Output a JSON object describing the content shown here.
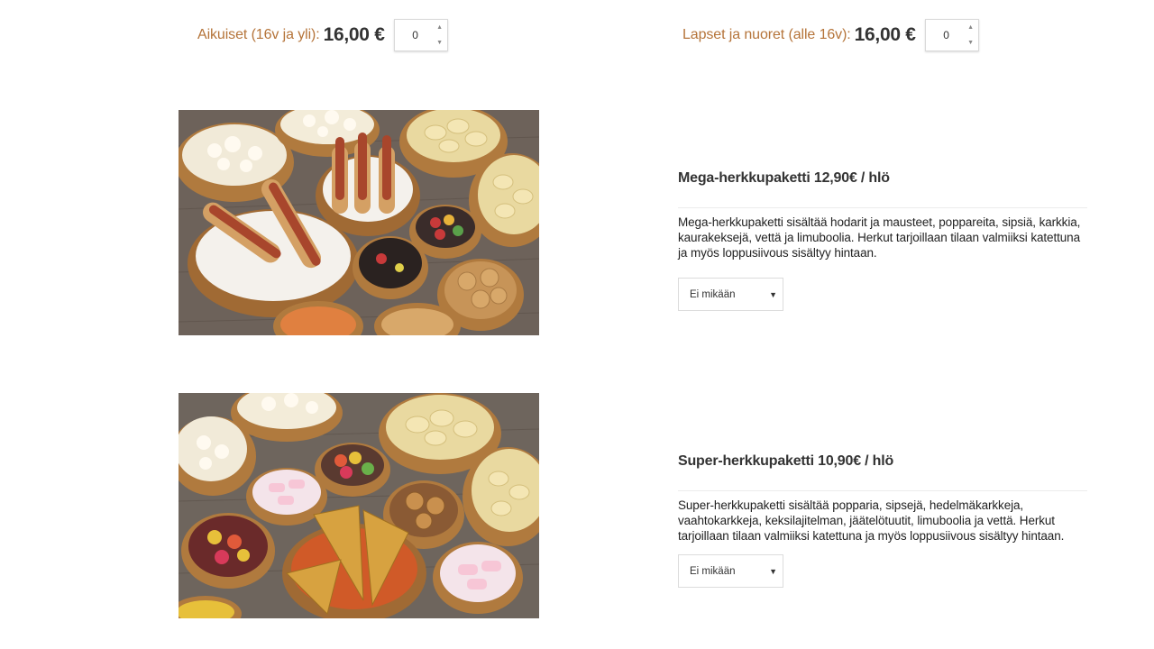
{
  "tickets": {
    "adult": {
      "label": "Aikuiset (16v ja yli):",
      "price": "16,00 €",
      "quantity": "0"
    },
    "child": {
      "label": "Lapset ja nuoret (alle 16v):",
      "price": "16,00 €",
      "quantity": "0"
    }
  },
  "products": [
    {
      "title": "Mega-herkkupaketti 12,90€ / hlö",
      "description": "Mega-herkkupaketti sisältää hodarit ja mausteet, poppareita, sipsiä, karkkia, kaurakeksejä, vettä ja limuboolia. Herkut tarjoillaan tilaan valmiiksi katettuna ja myös loppusiivous sisältyy hintaan.",
      "select_value": "Ei mikään"
    },
    {
      "title": "Super-herkkupaketti 10,90€ / hlö",
      "description": "Super-herkkupaketti sisältää popparia, sipsejä, hedelmäkarkkeja, vaahtokarkkeja, keksilajitelman, jäätelötuutit, limuboolia ja vettä. Herkut tarjoillaan tilaan valmiiksi katettuna ja myös loppusiivous sisältyy hintaan.",
      "select_value": "Ei mikään"
    }
  ],
  "icons": {
    "up": "▲",
    "down": "▼",
    "caret": "▼"
  }
}
